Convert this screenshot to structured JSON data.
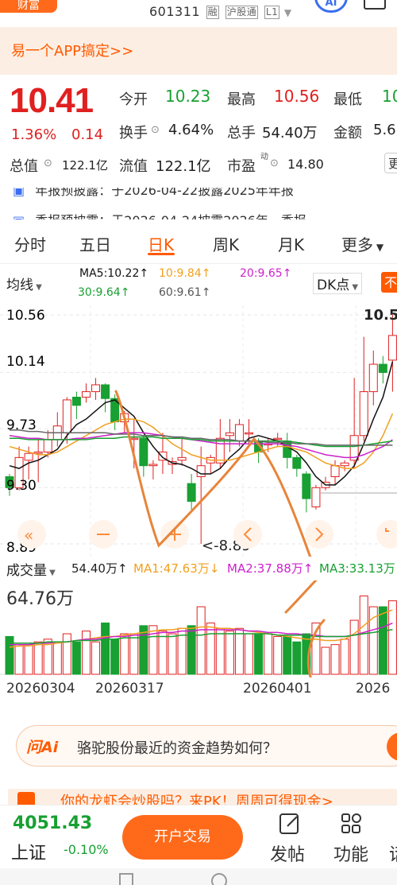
{
  "header": {
    "brand": "财富",
    "stock_code": "601311",
    "tags": [
      "融",
      "沪股通",
      "L1"
    ],
    "ai_label": "AI"
  },
  "banner": {
    "text": "易一个APP搞定>>"
  },
  "quote": {
    "price": "10.41",
    "change_pct": "1.36%",
    "change": "0.14",
    "fields": {
      "open_label": "今开",
      "open_value": "10.23",
      "high_label": "最高",
      "high_value": "10.56",
      "low_label": "最低",
      "low_value": "10",
      "turnover_label": "换手",
      "turnover_value": "4.64%",
      "volume_label": "总手",
      "volume_value": "54.40万",
      "amount_label": "金额",
      "amount_value": "5.6",
      "mktcap_label": "总值",
      "mktcap_value": "122.1亿",
      "float_label": "流值",
      "float_value": "122.1亿",
      "pe_label": "市盈",
      "pe_sup": "动",
      "pe_value": "14.80",
      "more_label": "更"
    }
  },
  "notices": [
    "年报预披露：于2026-04-22披露2025年年报",
    "季报预披露：于2026-04-24披露2026年一季报"
  ],
  "tabs": [
    "分时",
    "五日",
    "日K",
    "周K",
    "月K",
    "更多"
  ],
  "active_tab": "日K",
  "ma_bar": {
    "indicator": "均线",
    "ma5": "MA5:10.22↑",
    "ma10": "10:9.84↑",
    "ma20": "20:9.65↑",
    "ma30": "30:9.64↑",
    "ma60": "60:9.61↑",
    "dk": "DK点",
    "fq": "不"
  },
  "kline_axis": {
    "top": "10.56",
    "mid1": "10.14",
    "mid2": "9.73",
    "mid3": "9.30",
    "bottom": "8.89",
    "high_marker": "10.5",
    "low_marker": "<-8.89"
  },
  "volume_bar": {
    "indicator": "成交量",
    "vol": "54.40万↑",
    "ma1": "MA1:47.63万↓",
    "ma2": "MA2:37.88万↑",
    "ma3": "MA3:33.13万"
  },
  "volume_axis": {
    "top": "64.76万"
  },
  "dates": [
    "20260304",
    "20260317",
    "20260401",
    "2026"
  ],
  "ask_ai": {
    "logo": "问Ai",
    "question": "骆驼股份最近的资金趋势如何？"
  },
  "promo": {
    "text": "你的龙虾会炒股吗？来PK！周周可得现金>"
  },
  "bottom": {
    "index_value": "4051.43",
    "index_name": "上证",
    "index_change": "-0.10%",
    "trade_button": "开户交易",
    "post_label": "发帖",
    "func_label": "功能",
    "more_label": "话"
  },
  "colors": {
    "accent": "#ff5a00",
    "up": "#e02020",
    "down": "#18a032",
    "ma5": "#111111",
    "ma10": "#f0a020",
    "ma20": "#cc22cc",
    "ma30": "#18a032",
    "ma60": "#666666"
  },
  "chart_data": {
    "type": "candlestick",
    "ylim": [
      8.89,
      10.56
    ],
    "candles": [
      {
        "o": 9.38,
        "c": 9.3,
        "h": 9.4,
        "l": 9.24
      },
      {
        "o": 9.3,
        "c": 9.52,
        "h": 9.6,
        "l": 9.28
      },
      {
        "o": 9.5,
        "c": 9.55,
        "h": 9.6,
        "l": 9.36
      },
      {
        "o": 9.55,
        "c": 9.56,
        "h": 9.66,
        "l": 9.34
      },
      {
        "o": 9.56,
        "c": 9.65,
        "h": 9.72,
        "l": 9.52
      },
      {
        "o": 9.65,
        "c": 9.75,
        "h": 9.85,
        "l": 9.6
      },
      {
        "o": 9.7,
        "c": 9.94,
        "h": 9.96,
        "l": 9.62
      },
      {
        "o": 9.96,
        "c": 9.9,
        "h": 10.0,
        "l": 9.8
      },
      {
        "o": 9.96,
        "c": 10.0,
        "h": 10.06,
        "l": 9.92
      },
      {
        "o": 10.0,
        "c": 10.05,
        "h": 10.1,
        "l": 9.94
      },
      {
        "o": 10.05,
        "c": 9.95,
        "h": 10.06,
        "l": 9.85
      },
      {
        "o": 9.95,
        "c": 9.78,
        "h": 9.98,
        "l": 9.72
      },
      {
        "o": 9.78,
        "c": 9.84,
        "h": 9.86,
        "l": 9.7
      },
      {
        "o": 9.66,
        "c": 9.66,
        "h": 9.8,
        "l": 9.44
      },
      {
        "o": 9.66,
        "c": 9.46,
        "h": 9.68,
        "l": 9.38
      },
      {
        "o": 9.46,
        "c": 9.47,
        "h": 9.5,
        "l": 9.36
      },
      {
        "o": 9.5,
        "c": 9.56,
        "h": 9.7,
        "l": 9.4
      },
      {
        "o": 9.47,
        "c": 9.49,
        "h": 9.52,
        "l": 9.4
      },
      {
        "o": 9.5,
        "c": 9.52,
        "h": 9.66,
        "l": 9.46
      },
      {
        "o": 9.33,
        "c": 9.2,
        "h": 9.4,
        "l": 9.14
      },
      {
        "o": 9.38,
        "c": 9.46,
        "h": 9.6,
        "l": 8.89
      },
      {
        "o": 9.48,
        "c": 9.52,
        "h": 9.54,
        "l": 9.4
      },
      {
        "o": 9.48,
        "c": 9.66,
        "h": 9.8,
        "l": 9.44
      },
      {
        "o": 9.68,
        "c": 9.7,
        "h": 9.8,
        "l": 9.56
      },
      {
        "o": 9.64,
        "c": 9.76,
        "h": 9.8,
        "l": 9.6
      },
      {
        "o": 9.7,
        "c": 9.7,
        "h": 9.8,
        "l": 9.6
      },
      {
        "o": 9.64,
        "c": 9.56,
        "h": 9.66,
        "l": 9.48
      },
      {
        "o": 9.62,
        "c": 9.62,
        "h": 9.66,
        "l": 9.56
      },
      {
        "o": 9.66,
        "c": 9.66,
        "h": 9.7,
        "l": 9.6
      },
      {
        "o": 9.64,
        "c": 9.52,
        "h": 9.7,
        "l": 9.44
      },
      {
        "o": 9.52,
        "c": 9.44,
        "h": 9.54,
        "l": 9.38
      },
      {
        "o": 9.4,
        "c": 9.22,
        "h": 9.42,
        "l": 9.12
      },
      {
        "o": 9.16,
        "c": 9.3,
        "h": 9.32,
        "l": 9.14
      },
      {
        "o": 9.3,
        "c": 9.34,
        "h": 9.38,
        "l": 9.28
      },
      {
        "o": 9.38,
        "c": 9.46,
        "h": 9.5,
        "l": 9.32
      },
      {
        "o": 9.46,
        "c": 9.48,
        "h": 9.5,
        "l": 9.42
      },
      {
        "o": 9.5,
        "c": 9.68,
        "h": 10.1,
        "l": 9.44
      },
      {
        "o": 9.68,
        "c": 10.0,
        "h": 10.4,
        "l": 9.64
      },
      {
        "o": 10.0,
        "c": 10.2,
        "h": 10.3,
        "l": 9.9
      },
      {
        "o": 10.2,
        "c": 10.14,
        "h": 10.26,
        "l": 10.06
      },
      {
        "o": 10.23,
        "c": 10.41,
        "h": 10.56,
        "l": 10.0
      }
    ],
    "ma": {
      "MA5": [
        9.46,
        9.44,
        9.48,
        9.5,
        9.54,
        9.58,
        9.68,
        9.76,
        9.8,
        9.86,
        9.92,
        9.94,
        9.88,
        9.82,
        9.7,
        9.6,
        9.52,
        9.48,
        9.47,
        9.44,
        9.4,
        9.4,
        9.44,
        9.52,
        9.58,
        9.66,
        9.68,
        9.66,
        9.64,
        9.6,
        9.56,
        9.48,
        9.38,
        9.32,
        9.32,
        9.38,
        9.46,
        9.62,
        9.8,
        9.96,
        10.22
      ],
      "MA10": [
        9.6,
        9.58,
        9.56,
        9.54,
        9.54,
        9.56,
        9.6,
        9.64,
        9.68,
        9.72,
        9.76,
        9.78,
        9.8,
        9.8,
        9.78,
        9.74,
        9.68,
        9.62,
        9.58,
        9.54,
        9.52,
        9.5,
        9.5,
        9.5,
        9.52,
        9.54,
        9.56,
        9.58,
        9.6,
        9.6,
        9.58,
        9.56,
        9.52,
        9.48,
        9.46,
        9.44,
        9.44,
        9.48,
        9.56,
        9.68,
        9.84
      ],
      "MA20": [
        9.68,
        9.67,
        9.66,
        9.66,
        9.65,
        9.65,
        9.65,
        9.66,
        9.66,
        9.67,
        9.68,
        9.69,
        9.7,
        9.7,
        9.7,
        9.69,
        9.68,
        9.67,
        9.66,
        9.65,
        9.64,
        9.63,
        9.62,
        9.62,
        9.62,
        9.62,
        9.62,
        9.62,
        9.62,
        9.61,
        9.6,
        9.58,
        9.56,
        9.54,
        9.53,
        9.52,
        9.52,
        9.54,
        9.57,
        9.6,
        9.65
      ],
      "MA30": [
        9.66,
        9.66,
        9.65,
        9.65,
        9.65,
        9.65,
        9.65,
        9.65,
        9.65,
        9.66,
        9.66,
        9.66,
        9.67,
        9.67,
        9.67,
        9.67,
        9.66,
        9.66,
        9.66,
        9.65,
        9.65,
        9.64,
        9.64,
        9.64,
        9.64,
        9.64,
        9.64,
        9.64,
        9.64,
        9.64,
        9.63,
        9.62,
        9.61,
        9.6,
        9.6,
        9.6,
        9.6,
        9.61,
        9.62,
        9.63,
        9.64
      ],
      "MA60": [
        9.72,
        9.72,
        9.71,
        9.71,
        9.7,
        9.7,
        9.7,
        9.7,
        9.7,
        9.7,
        9.7,
        9.69,
        9.69,
        9.69,
        9.68,
        9.68,
        9.68,
        9.67,
        9.67,
        9.66,
        9.66,
        9.65,
        9.65,
        9.65,
        9.64,
        9.64,
        9.64,
        9.63,
        9.63,
        9.63,
        9.62,
        9.62,
        9.62,
        9.61,
        9.61,
        9.61,
        9.61,
        9.61,
        9.61,
        9.61,
        9.61
      ]
    },
    "volume": {
      "ylim": [
        0,
        64.76
      ],
      "values": [
        28,
        22,
        22,
        24,
        26,
        24,
        30,
        24,
        32,
        24,
        38,
        26,
        30,
        30,
        36,
        36,
        32,
        30,
        34,
        36,
        50,
        38,
        34,
        32,
        34,
        30,
        30,
        30,
        28,
        28,
        24,
        30,
        38,
        20,
        22,
        26,
        40,
        58,
        50,
        50,
        54.4
      ],
      "MA1": [
        20,
        21,
        21,
        22,
        22,
        23,
        24,
        25,
        26,
        27,
        28,
        28,
        29,
        30,
        31,
        32,
        33,
        33,
        34,
        34,
        35,
        35,
        34,
        34,
        33,
        32,
        31,
        30,
        29,
        28,
        27,
        26,
        26,
        25,
        25,
        26,
        30,
        36,
        42,
        45,
        47.63
      ],
      "MA2": [
        22,
        22,
        22,
        23,
        23,
        24,
        24,
        25,
        26,
        26,
        27,
        28,
        28,
        29,
        29,
        30,
        31,
        31,
        32,
        32,
        33,
        33,
        33,
        33,
        33,
        32,
        32,
        31,
        31,
        30,
        30,
        29,
        29,
        28,
        28,
        28,
        29,
        31,
        33,
        35,
        37.88
      ],
      "MA3": [
        23,
        23,
        23,
        23,
        24,
        24,
        24,
        25,
        25,
        25,
        26,
        26,
        27,
        27,
        27,
        28,
        28,
        28,
        29,
        29,
        29,
        30,
        30,
        30,
        30,
        30,
        30,
        30,
        29,
        29,
        29,
        29,
        28,
        28,
        28,
        28,
        29,
        30,
        31,
        32,
        33.13
      ]
    }
  }
}
